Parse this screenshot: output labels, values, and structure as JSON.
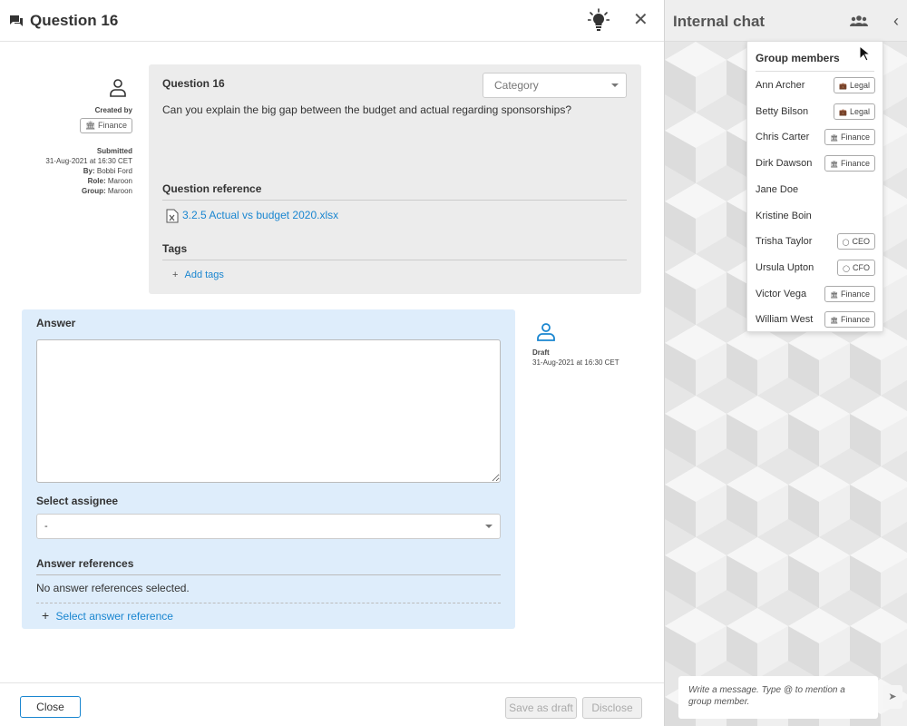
{
  "header": {
    "title": "Question 16",
    "close": "✕"
  },
  "meta": {
    "created_by_label": "Created by",
    "group_badge": "Finance",
    "submitted_label": "Submitted",
    "submitted_date": "31-Aug-2021 at 16:30 CET",
    "by_label": "By:",
    "by_value": "Bobbi Ford",
    "role_label": "Role:",
    "role_value": "Maroon",
    "group_label": "Group:",
    "group_value": "Maroon"
  },
  "question": {
    "title": "Question 16",
    "text": "Can you explain the big gap between the budget and actual regarding sponsorships?",
    "category_placeholder": "Category",
    "reference_label": "Question reference",
    "reference_file": "3.2.5 Actual vs budget 2020.xlsx",
    "tags_label": "Tags",
    "add_tags": "Add tags"
  },
  "answer": {
    "label": "Answer",
    "assignee_label": "Select assignee",
    "assignee_value": "-",
    "references_label": "Answer references",
    "no_references": "No answer references selected.",
    "select_reference": "Select answer reference"
  },
  "draft": {
    "status": "Draft",
    "date": "31-Aug-2021 at 16:30 CET"
  },
  "footer": {
    "close": "Close",
    "save_draft": "Save as draft",
    "disclose": "Disclose"
  },
  "chat": {
    "title": "Internal chat",
    "members_title": "Group members",
    "members": [
      {
        "name": "Ann Archer",
        "tag": "Legal",
        "tag_icon": "briefcase-icon"
      },
      {
        "name": "Betty Bilson",
        "tag": "Legal",
        "tag_icon": "briefcase-icon"
      },
      {
        "name": "Chris Carter",
        "tag": "Finance",
        "tag_icon": "bank-icon"
      },
      {
        "name": "Dirk Dawson",
        "tag": "Finance",
        "tag_icon": "bank-icon"
      },
      {
        "name": "Jane Doe",
        "tag": "",
        "tag_icon": ""
      },
      {
        "name": "Kristine Boin",
        "tag": "",
        "tag_icon": ""
      },
      {
        "name": "Trisha Taylor",
        "tag": "CEO",
        "tag_icon": "tag-icon"
      },
      {
        "name": "Ursula Upton",
        "tag": "CFO",
        "tag_icon": "tag-icon"
      },
      {
        "name": "Victor Vega",
        "tag": "Finance",
        "tag_icon": "bank-icon"
      },
      {
        "name": "William West",
        "tag": "Finance",
        "tag_icon": "bank-icon"
      }
    ],
    "message_placeholder": "Write a message. Type @ to mention a group member.",
    "send": "➤"
  },
  "colors": {
    "accent": "#1a86d0",
    "answer_bg": "#deedfb",
    "card_bg": "#ececec"
  }
}
